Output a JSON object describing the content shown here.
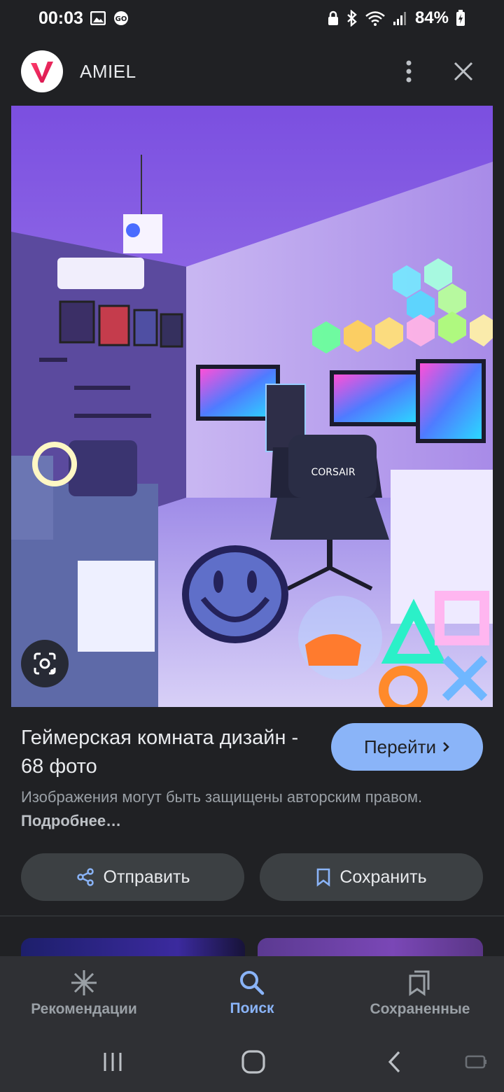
{
  "status": {
    "time": "00:03",
    "battery": "84%"
  },
  "header": {
    "site_name": "AMIEL"
  },
  "result": {
    "title": "Геймерская комната дизайн - 68 фото",
    "visit_label": "Перейти",
    "copyright_text": "Изображения могут быть защищены авторским правом.",
    "learn_more": "Подробнее…"
  },
  "actions": {
    "share_label": "Отправить",
    "save_label": "Сохранить"
  },
  "bottom_nav": [
    {
      "label": "Рекомендации",
      "icon": "asterisk-icon",
      "active": false
    },
    {
      "label": "Поиск",
      "icon": "search-icon",
      "active": true
    },
    {
      "label": "Сохраненные",
      "icon": "saved-collections-icon",
      "active": false
    }
  ],
  "colors": {
    "accent": "#8ab4f8",
    "background": "#202124",
    "surface": "#3c4043"
  }
}
